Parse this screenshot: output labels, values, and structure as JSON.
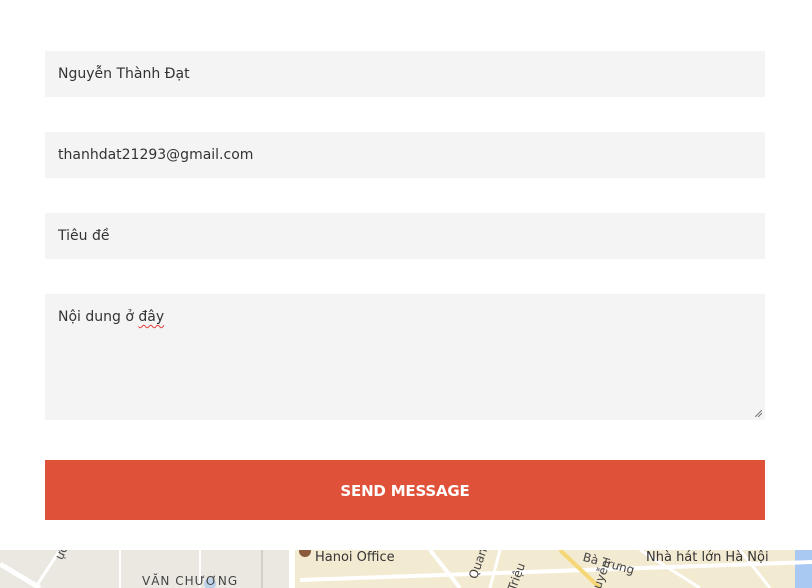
{
  "form": {
    "name_value": "Nguyễn Thành Đạt",
    "email_value": "thanhdat21293@gmail.com",
    "subject_value": "Tiêu đề",
    "message_prefix": "Nội dung ở ",
    "message_misspelled": "đây",
    "send_label": "SEND MESSAGE"
  },
  "map": {
    "labels": [
      "ực Thần",
      "VĂN CHƯƠNG",
      "Hanoi Office",
      "Quan",
      "Triệu",
      "uyễn",
      "Bà Trưng",
      "Nhà hát lớn Hà Nội"
    ]
  },
  "colors": {
    "field_bg": "#f4f4f4",
    "button_bg": "#df5138",
    "button_text": "#ffffff"
  }
}
